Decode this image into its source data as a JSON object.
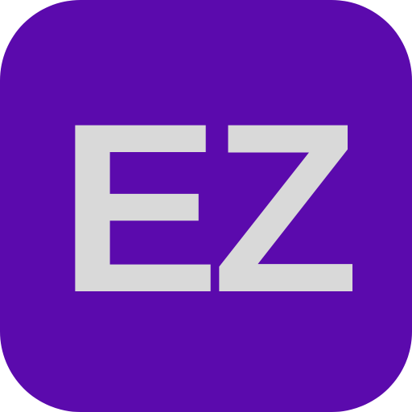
{
  "icon": {
    "monogram": "EZ",
    "background_color": "#5b0aad",
    "text_color": "#d9d9d9"
  }
}
